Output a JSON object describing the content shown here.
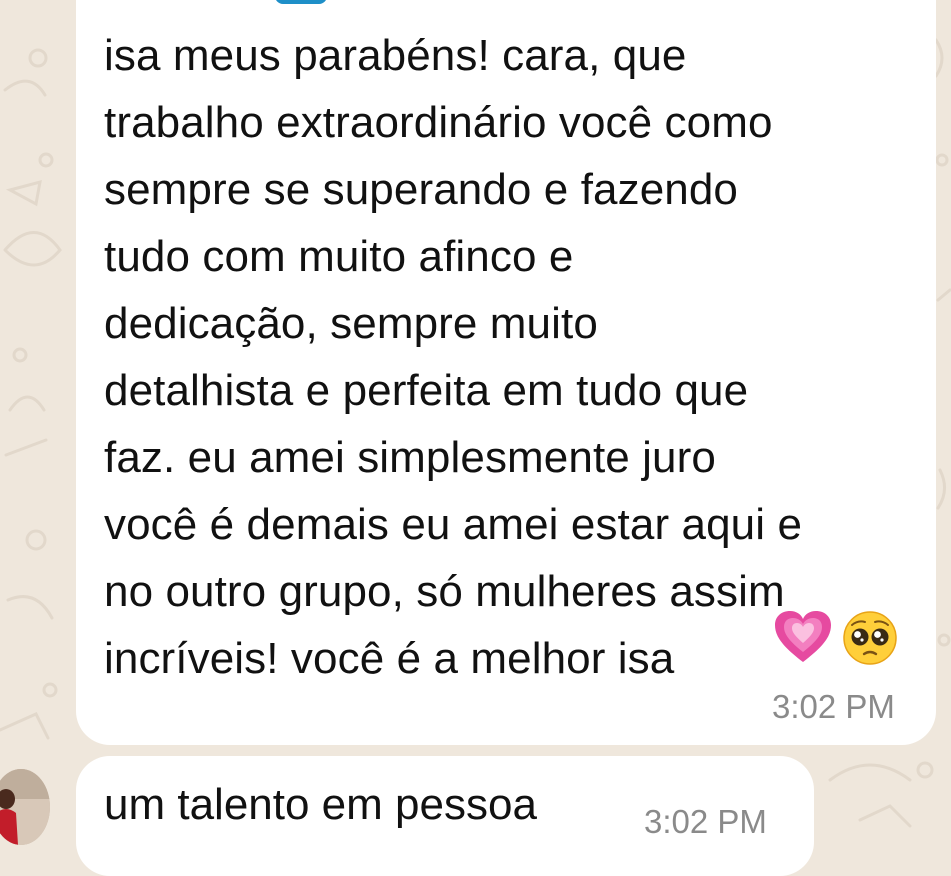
{
  "chat": {
    "messages": [
      {
        "text": "isa meus parabéns! cara, que\ntrabalho extraordinário você como\nsempre se superando e fazendo\ntudo com muito afinco e\ndedicação, sempre muito\ndetalhista e perfeita em tudo que\nfaz. eu amei simplesmente juro\nvocê é demais eu amei estar aqui e\nno outro grupo, só mulheres assim\nincríveis! você é a melhor isa",
        "time": "3:02 PM",
        "emojis": [
          "growing-heart-icon",
          "pleading-face-icon"
        ]
      },
      {
        "text": "um talento em pessoa",
        "time": "3:02 PM"
      }
    ]
  },
  "colors": {
    "wallpaper": "#efe7dc",
    "bubble": "#ffffff",
    "text": "#111111",
    "timestamp": "#8a8a8a",
    "sender_name": "#1e8fc8"
  }
}
